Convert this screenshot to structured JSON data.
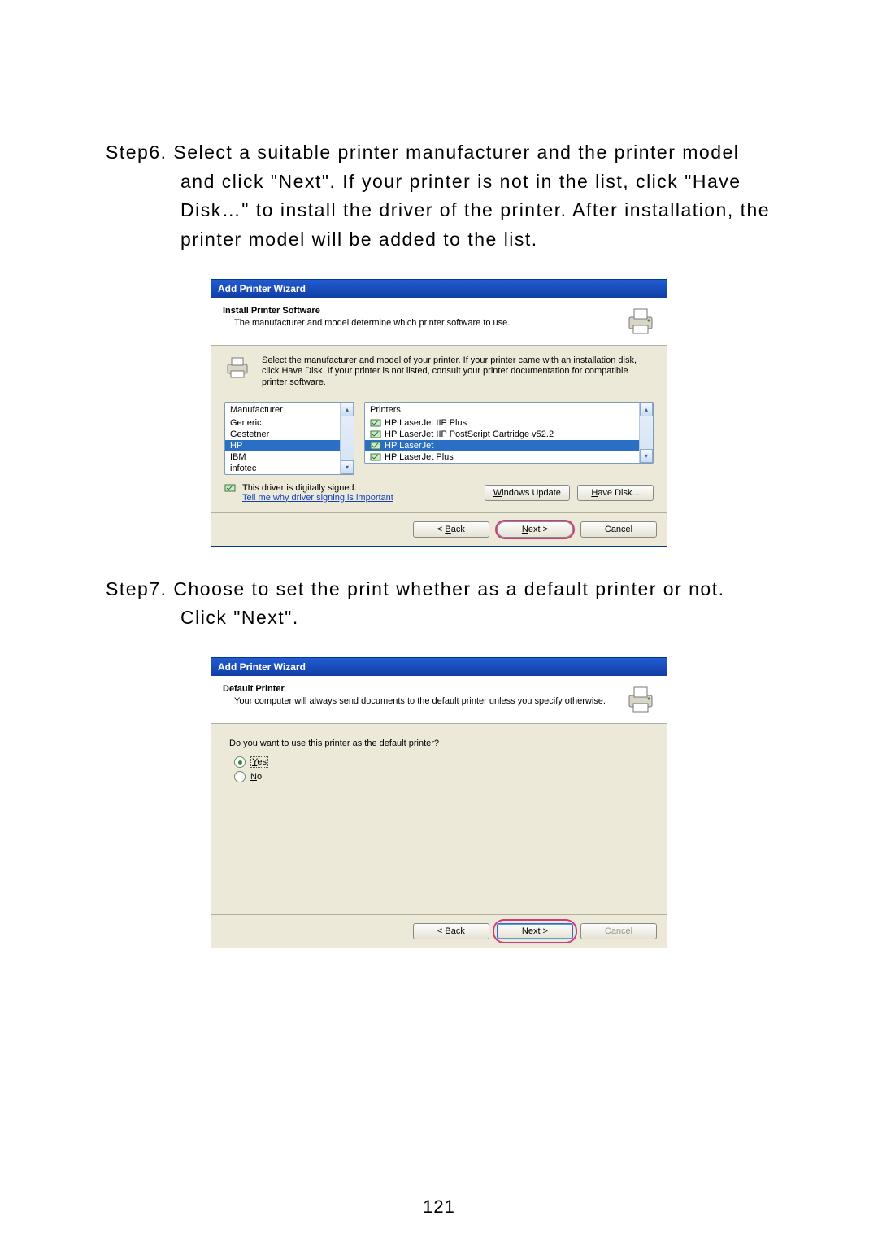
{
  "page_number": "121",
  "step6": {
    "label": "Step6.",
    "text": "Select a suitable printer manufacturer and the printer model and click \"Next\". If your printer is not in the list, click \"Have Disk…\" to install the driver of the printer. After installation, the printer model will be added to the list."
  },
  "step7": {
    "label": "Step7.",
    "text": "Choose to set the print whether as a default printer or not. Click \"Next\"."
  },
  "wizard1": {
    "title": "Add Printer Wizard",
    "htitle": "Install Printer Software",
    "hsub": "The manufacturer and model determine which printer software to use.",
    "msg": "Select the manufacturer and model of your printer. If your printer came with an installation disk, click Have Disk. If your printer is not listed, consult your printer documentation for compatible printer software.",
    "mfr_label": "Manufacturer",
    "mfrs": [
      "Generic",
      "Gestetner",
      "HP",
      "IBM",
      "infotec"
    ],
    "mfr_selected_index": 2,
    "ptr_label": "Printers",
    "ptrs": [
      "HP LaserJet IIP Plus",
      "HP LaserJet IIP PostScript Cartridge v52.2",
      "HP LaserJet",
      "HP LaserJet Plus"
    ],
    "ptr_selected_index": 2,
    "sig_text": "This driver is digitally signed.",
    "sig_link": "Tell me why driver signing is important",
    "btn_winupdate": "Windows Update",
    "btn_havedisk": "Have Disk...",
    "btn_back": "< ",
    "btn_back_u": "B",
    "btn_back_tail": "ack",
    "btn_next_u": "N",
    "btn_next_tail": "ext >",
    "btn_cancel": "Cancel"
  },
  "wizard2": {
    "title": "Add Printer Wizard",
    "htitle": "Default Printer",
    "hsub": "Your computer will always send documents to the default printer unless you specify otherwise.",
    "question": "Do you want to use this printer as the default printer?",
    "yes_u": "Y",
    "yes_tail": "es",
    "no_u": "N",
    "no_tail": "o",
    "btn_back": "< ",
    "btn_back_u": "B",
    "btn_back_tail": "ack",
    "btn_next_u": "N",
    "btn_next_tail": "ext >",
    "btn_cancel": "Cancel"
  }
}
